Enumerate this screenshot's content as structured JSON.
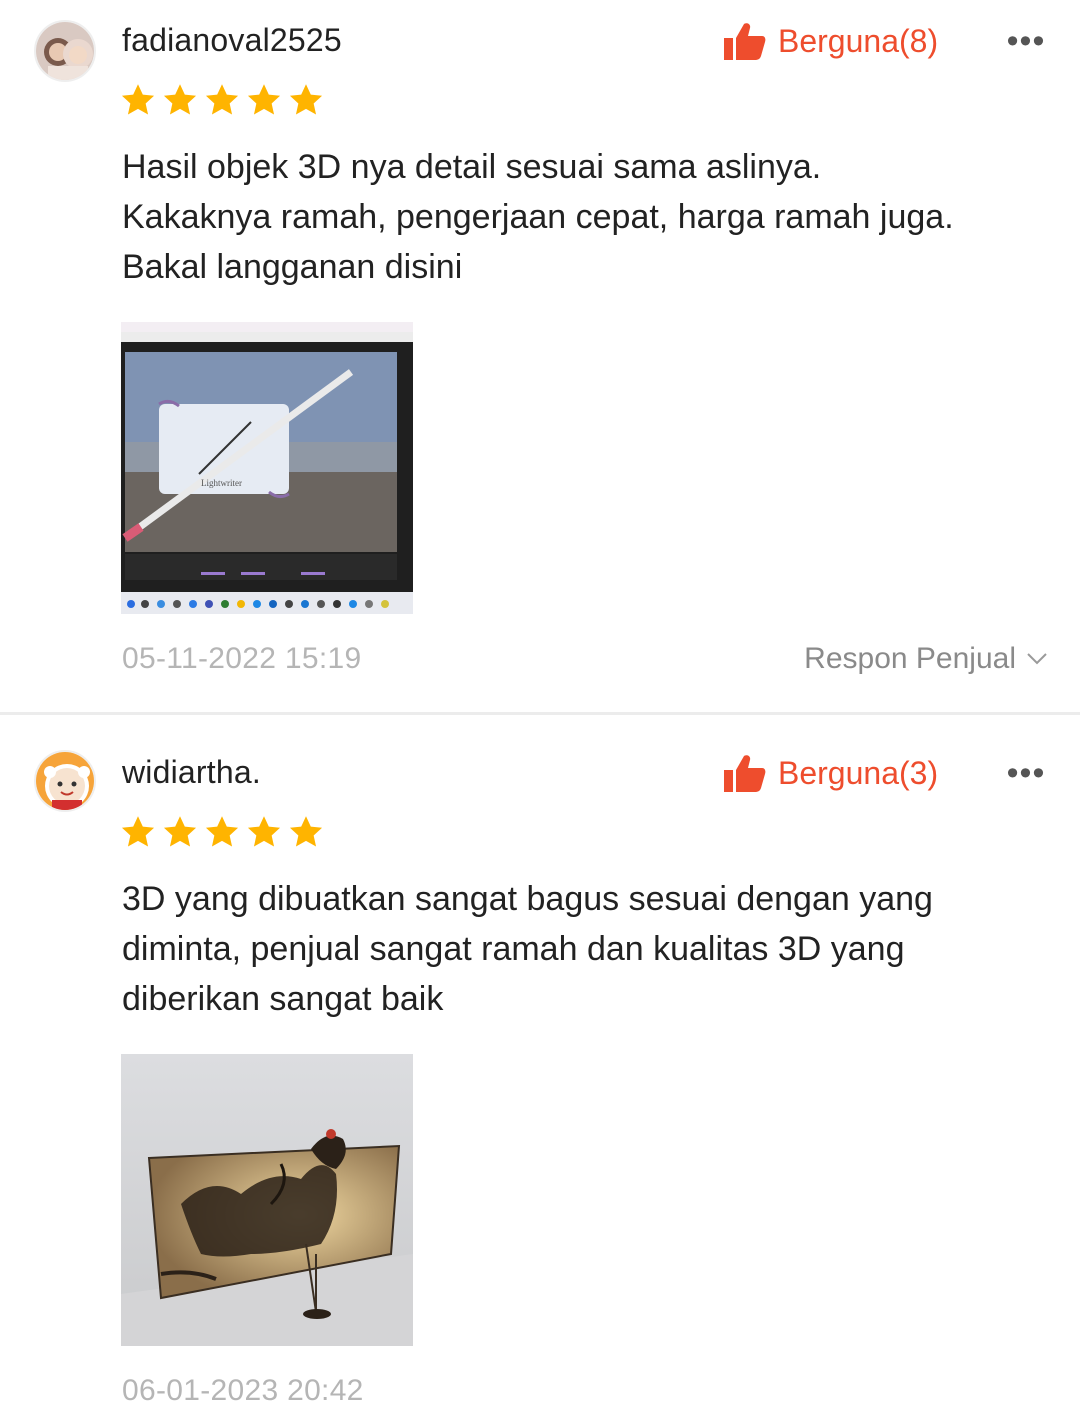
{
  "colors": {
    "accent": "#ee4d2d",
    "star": "#ffb400",
    "text": "#222222",
    "muted": "#b5b5b5"
  },
  "reviews": [
    {
      "username": "fadianoval2525",
      "helpful_label": "Berguna(8)",
      "rating": 5,
      "comment_lines": [
        "Hasil objek 3D nya detail sesuai sama aslinya.",
        "Kakaknya ramah, pengerjaan cepat, harga ramah juga.",
        "Bakal langganan disini"
      ],
      "photo_icon": "3d-modeling-screenshot",
      "timestamp": "05-11-2022 15:19",
      "seller_response_label": "Respon Penjual"
    },
    {
      "username": "widiartha.",
      "helpful_label": "Berguna(3)",
      "rating": 5,
      "comment_lines": [
        "3D yang dibuatkan sangat bagus sesuai dengan yang",
        "diminta, penjual sangat ramah dan kualitas 3D yang",
        "diberikan sangat baik"
      ],
      "photo_icon": "wayang-3d-render",
      "timestamp": "06-01-2023 20:42"
    }
  ],
  "more_icon": "more-horizontal-icon"
}
